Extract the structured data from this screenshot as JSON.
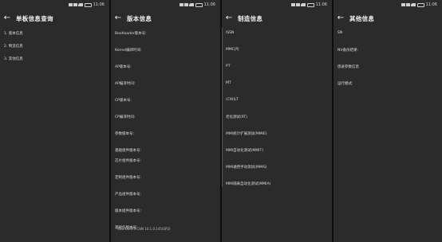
{
  "statusbar": {
    "time": "11:06"
  },
  "panels": [
    {
      "title": "单板信息查询",
      "items": [
        "1. 版本信息",
        "2. 制造信息",
        "3. 其他信息"
      ]
    },
    {
      "title": "版本信息",
      "items": [
        "Bootloader版本号:",
        "Kernel编译时间:",
        "AP版本号:",
        "AP编译时间:",
        "CP版本号:",
        "CP编译时间:",
        "参数版本号:",
        "基础组件版本号:",
        "芯片组件版本号:",
        "定制组件版本号:",
        "产品组件版本号:",
        "版本组件版本号:",
        "基础包版本号:"
      ],
      "values": {
        "base_component": "·",
        "base_package": "ELS-LGRP3-CHN 10.1.0.145(SP3)"
      }
    },
    {
      "title": "制造信息",
      "items": [
        "ISSN",
        "MMC|P|",
        "PT",
        "MT",
        "(CW)LT",
        "老化测试(RT)",
        "MMI统计扩展测试(MMIE)",
        "MMI自动化测试(MMIT)",
        "MMI通用手动测试(MMIS)",
        "MMI隔离自动化测试(MMIA)"
      ]
    },
    {
      "title": "其他信息",
      "items": [
        "SN",
        "NV备份结果:",
        "烧录参数信息",
        "运行模式:"
      ]
    }
  ]
}
